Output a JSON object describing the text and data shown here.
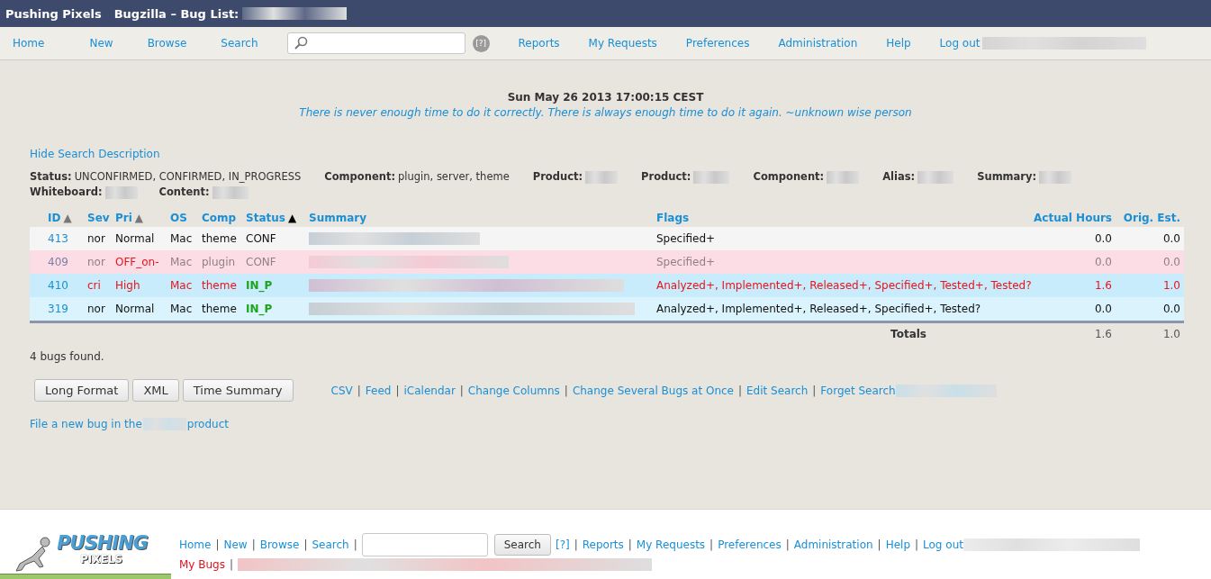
{
  "title_bar": {
    "site": "Pushing Pixels",
    "page": "Bugzilla – Bug List:"
  },
  "nav": {
    "left": [
      "Home",
      "New",
      "Browse",
      "Search"
    ],
    "help": "[?]",
    "right": [
      "Reports",
      "My Requests",
      "Preferences",
      "Administration",
      "Help",
      "Log out"
    ]
  },
  "header": {
    "date": "Sun May 26 2013 17:00:15 CEST",
    "quote": "There is never enough time to do it correctly. There is always enough time to do it again. ~unknown wise person"
  },
  "search_description": {
    "toggle": "Hide Search Description",
    "lines": [
      [
        {
          "label": "Status:",
          "value": "UNCONFIRMED, CONFIRMED, IN_PROGRESS"
        },
        {
          "label": "Component:",
          "value": "plugin, server, theme"
        },
        {
          "label": "Product:"
        },
        {
          "label": "Product:"
        },
        {
          "label": "Component:"
        },
        {
          "label": "Alias:"
        },
        {
          "label": "Summary:"
        }
      ],
      [
        {
          "label": "Whiteboard:"
        },
        {
          "label": "Content:"
        }
      ]
    ]
  },
  "table": {
    "columns": [
      {
        "label": "ID",
        "arrow": "▲",
        "primary": false
      },
      {
        "label": "Sev"
      },
      {
        "label": "Pri",
        "arrow": "▲",
        "primary": false
      },
      {
        "label": "OS"
      },
      {
        "label": "Comp"
      },
      {
        "label": "Status",
        "arrow": "▲",
        "primary": true
      },
      {
        "label": "Summary"
      },
      {
        "label": "Flags"
      },
      {
        "label": "Actual Hours"
      },
      {
        "label": "Orig. Est."
      }
    ],
    "rows": [
      {
        "kind": "normal",
        "id": "413",
        "sev": "nor",
        "pri": "Normal",
        "pri_alert": false,
        "os": "Mac",
        "comp": "theme",
        "status": "CONF",
        "status_active": false,
        "flags": "Specified+",
        "actual": "0.0",
        "orig": "0.0"
      },
      {
        "kind": "muted",
        "id": "409",
        "sev": "nor",
        "pri": "OFF_on-",
        "pri_alert": true,
        "os": "Mac",
        "comp": "plugin",
        "status": "CONF",
        "status_active": false,
        "flags": "Specified+",
        "actual": "0.0",
        "orig": "0.0"
      },
      {
        "kind": "critical",
        "id": "410",
        "sev": "cri",
        "pri": "High",
        "pri_alert": true,
        "os": "Mac",
        "comp": "theme",
        "status": "IN_P",
        "status_active": true,
        "flags": "Analyzed+, Implemented+, Released+, Specified+, Tested+, Tested?",
        "actual": "1.6",
        "orig": "1.0"
      },
      {
        "kind": "assigned",
        "id": "319",
        "sev": "nor",
        "pri": "Normal",
        "pri_alert": false,
        "os": "Mac",
        "comp": "theme",
        "status": "IN_P",
        "status_active": true,
        "flags": "Analyzed+, Implemented+, Released+, Specified+, Tested?",
        "actual": "0.0",
        "orig": "0.0"
      }
    ],
    "totals": {
      "label": "Totals",
      "actual": "1.6",
      "orig": "1.0"
    }
  },
  "separator": "|",
  "count": "4 bugs found.",
  "buttons": [
    "Long Format",
    "XML",
    "Time Summary"
  ],
  "links": [
    "CSV",
    "Feed",
    "iCalendar",
    "Change Columns",
    "Change Several Bugs at Once",
    "Edit Search",
    "Forget Search"
  ],
  "new_bug": {
    "before": "File a new bug in the",
    "after": "product"
  },
  "footer": {
    "logo_top": "PUSHING",
    "logo_bottom": "PIXELS",
    "left": [
      "Home",
      "New",
      "Browse",
      "Search"
    ],
    "search_button": "Search",
    "right": [
      "[?]",
      "Reports",
      "My Requests",
      "Preferences",
      "Administration",
      "Help",
      "Log out"
    ],
    "my_bugs": "My Bugs"
  }
}
